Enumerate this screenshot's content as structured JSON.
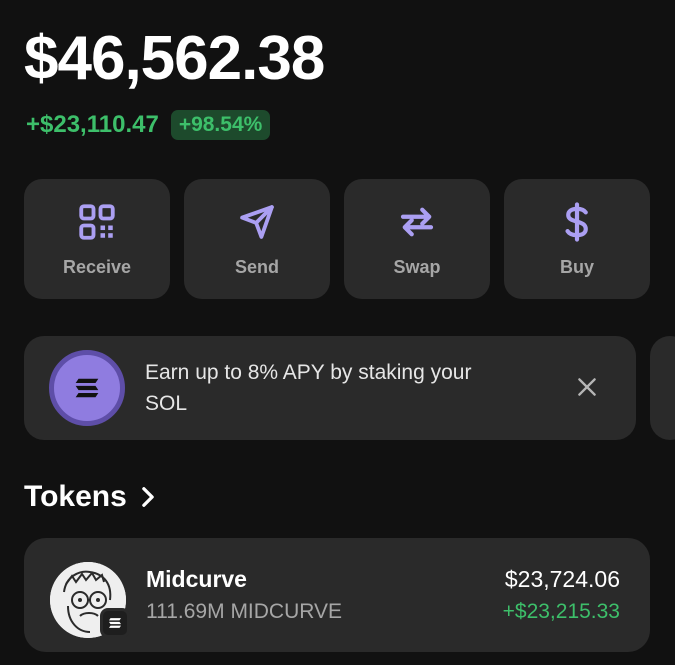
{
  "balance": "$46,562.38",
  "change": {
    "amount": "+$23,110.47",
    "percent": "+98.54%"
  },
  "actions": [
    {
      "label": "Receive",
      "icon": "qr-code-icon"
    },
    {
      "label": "Send",
      "icon": "paper-plane-icon"
    },
    {
      "label": "Swap",
      "icon": "swap-arrows-icon"
    },
    {
      "label": "Buy",
      "icon": "dollar-icon"
    }
  ],
  "banner": {
    "text": "Earn up to 8% APY by staking your SOL",
    "icon": "solana-icon",
    "close_icon": "close-icon"
  },
  "tokens": {
    "title": "Tokens",
    "items": [
      {
        "name": "Midcurve",
        "amount": "111.69M MIDCURVE",
        "value": "$23,724.06",
        "change": "+$23,215.33"
      }
    ]
  },
  "colors": {
    "background": "#111111",
    "card": "#2a2a2a",
    "accent": "#ab9ff2",
    "positive": "#3dbf6a",
    "muted": "#a6a6a6"
  }
}
